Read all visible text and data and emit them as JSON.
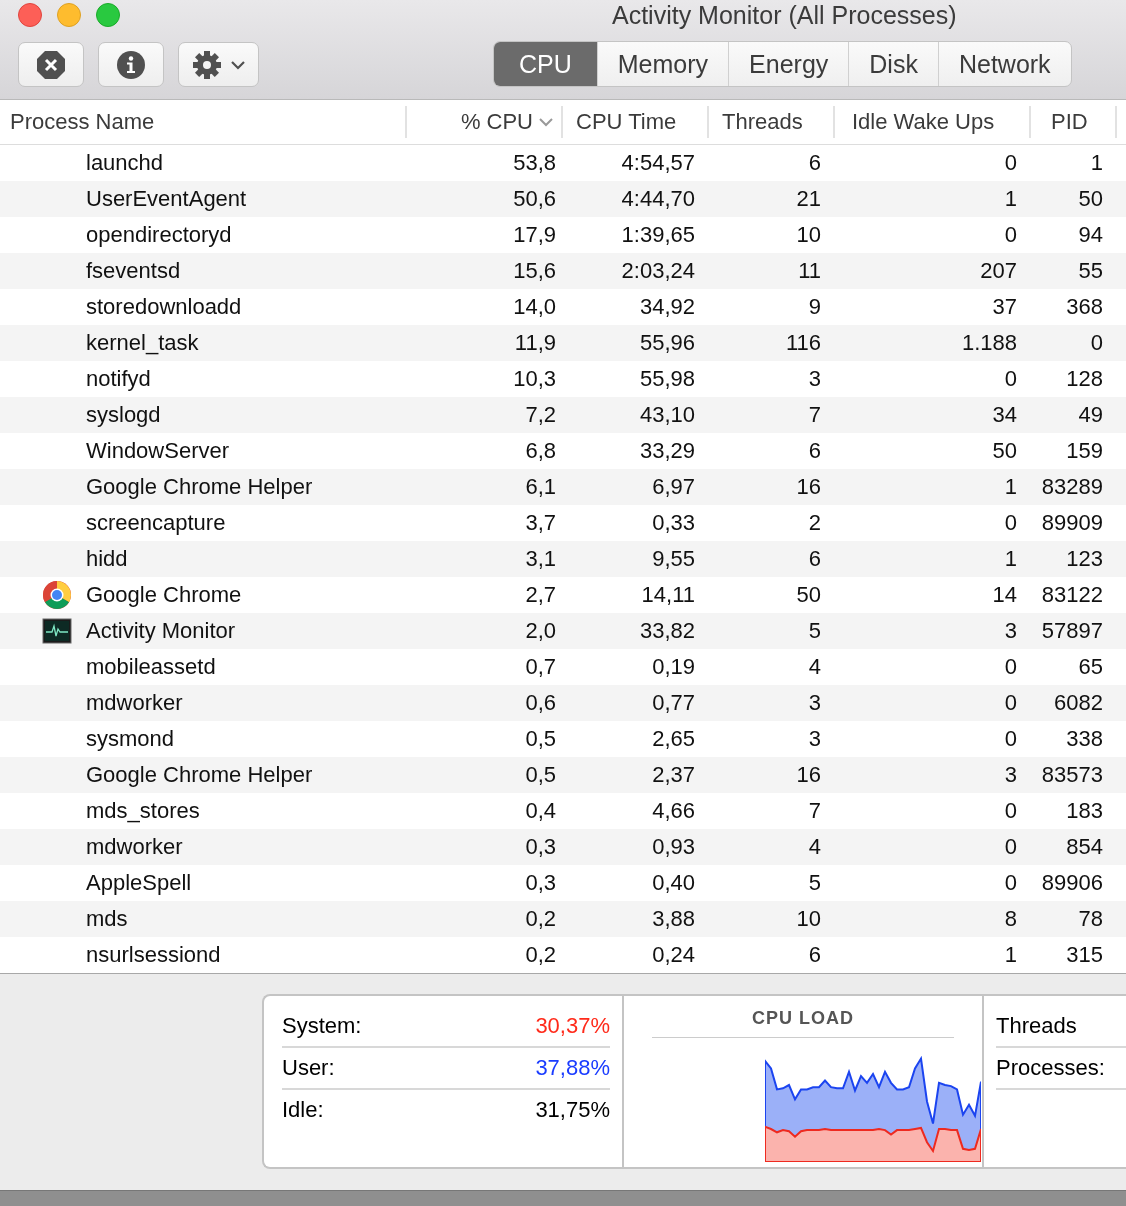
{
  "window": {
    "title": "Activity Monitor (All Processes)"
  },
  "tabs": [
    {
      "label": "CPU",
      "selected": true
    },
    {
      "label": "Memory",
      "selected": false
    },
    {
      "label": "Energy",
      "selected": false
    },
    {
      "label": "Disk",
      "selected": false
    },
    {
      "label": "Network",
      "selected": false
    }
  ],
  "table": {
    "columns": [
      {
        "label": "Process Name",
        "sorted": false
      },
      {
        "label": "% CPU",
        "sorted": true
      },
      {
        "label": "CPU Time",
        "sorted": false
      },
      {
        "label": "Threads",
        "sorted": false
      },
      {
        "label": "Idle Wake Ups",
        "sorted": false
      },
      {
        "label": "PID",
        "sorted": false
      }
    ],
    "rows": [
      {
        "kind": "daemon",
        "cells": [
          "launchd",
          "53,8",
          "4:54,57",
          "6",
          "0",
          "1"
        ]
      },
      {
        "kind": "daemon",
        "cells": [
          "UserEventAgent",
          "50,6",
          "4:44,70",
          "21",
          "1",
          "50"
        ]
      },
      {
        "kind": "daemon",
        "cells": [
          "opendirectoryd",
          "17,9",
          "1:39,65",
          "10",
          "0",
          "94"
        ]
      },
      {
        "kind": "daemon",
        "cells": [
          "fseventsd",
          "15,6",
          "2:03,24",
          "11",
          "207",
          "55"
        ]
      },
      {
        "kind": "daemon",
        "cells": [
          "storedownloadd",
          "14,0",
          "34,92",
          "9",
          "37",
          "368"
        ]
      },
      {
        "kind": "daemon",
        "cells": [
          "kernel_task",
          "11,9",
          "55,96",
          "116",
          "1.188",
          "0"
        ]
      },
      {
        "kind": "daemon",
        "cells": [
          "notifyd",
          "10,3",
          "55,98",
          "3",
          "0",
          "128"
        ]
      },
      {
        "kind": "daemon",
        "cells": [
          "syslogd",
          "7,2",
          "43,10",
          "7",
          "34",
          "49"
        ]
      },
      {
        "kind": "daemon",
        "cells": [
          "WindowServer",
          "6,8",
          "33,29",
          "6",
          "50",
          "159"
        ]
      },
      {
        "kind": "daemon",
        "cells": [
          "Google Chrome Helper",
          "6,1",
          "6,97",
          "16",
          "1",
          "83289"
        ]
      },
      {
        "kind": "daemon",
        "cells": [
          "screencapture",
          "3,7",
          "0,33",
          "2",
          "0",
          "89909"
        ]
      },
      {
        "kind": "daemon",
        "cells": [
          "hidd",
          "3,1",
          "9,55",
          "6",
          "1",
          "123"
        ]
      },
      {
        "kind": "browser",
        "cells": [
          "Google Chrome",
          "2,7",
          "14,11",
          "50",
          "14",
          "83122"
        ]
      },
      {
        "kind": "monitor",
        "cells": [
          "Activity Monitor",
          "2,0",
          "33,82",
          "5",
          "3",
          "57897"
        ]
      },
      {
        "kind": "daemon",
        "cells": [
          "mobileassetd",
          "0,7",
          "0,19",
          "4",
          "0",
          "65"
        ]
      },
      {
        "kind": "daemon",
        "cells": [
          "mdworker",
          "0,6",
          "0,77",
          "3",
          "0",
          "6082"
        ]
      },
      {
        "kind": "daemon",
        "cells": [
          "sysmond",
          "0,5",
          "2,65",
          "3",
          "0",
          "338"
        ]
      },
      {
        "kind": "daemon",
        "cells": [
          "Google Chrome Helper",
          "0,5",
          "2,37",
          "16",
          "3",
          "83573"
        ]
      },
      {
        "kind": "daemon",
        "cells": [
          "mds_stores",
          "0,4",
          "4,66",
          "7",
          "0",
          "183"
        ]
      },
      {
        "kind": "daemon",
        "cells": [
          "mdworker",
          "0,3",
          "0,93",
          "4",
          "0",
          "854"
        ]
      },
      {
        "kind": "daemon",
        "cells": [
          "AppleSpell",
          "0,3",
          "0,40",
          "5",
          "0",
          "89906"
        ]
      },
      {
        "kind": "daemon",
        "cells": [
          "mds",
          "0,2",
          "3,88",
          "10",
          "8",
          "78"
        ]
      },
      {
        "kind": "daemon",
        "cells": [
          "nsurlsessiond",
          "0,2",
          "0,24",
          "6",
          "1",
          "315"
        ]
      }
    ]
  },
  "summary": {
    "stats": [
      {
        "label": "System:",
        "value": "30,37%",
        "color": "#ff2a1a"
      },
      {
        "label": "User:",
        "value": "37,88%",
        "color": "#1a3cff"
      },
      {
        "label": "Idle:",
        "value": "31,75%",
        "color": "#000000"
      }
    ],
    "graph_title": "CPU LOAD",
    "counts": [
      {
        "label": "Threads"
      },
      {
        "label": "Processes:"
      }
    ]
  }
}
